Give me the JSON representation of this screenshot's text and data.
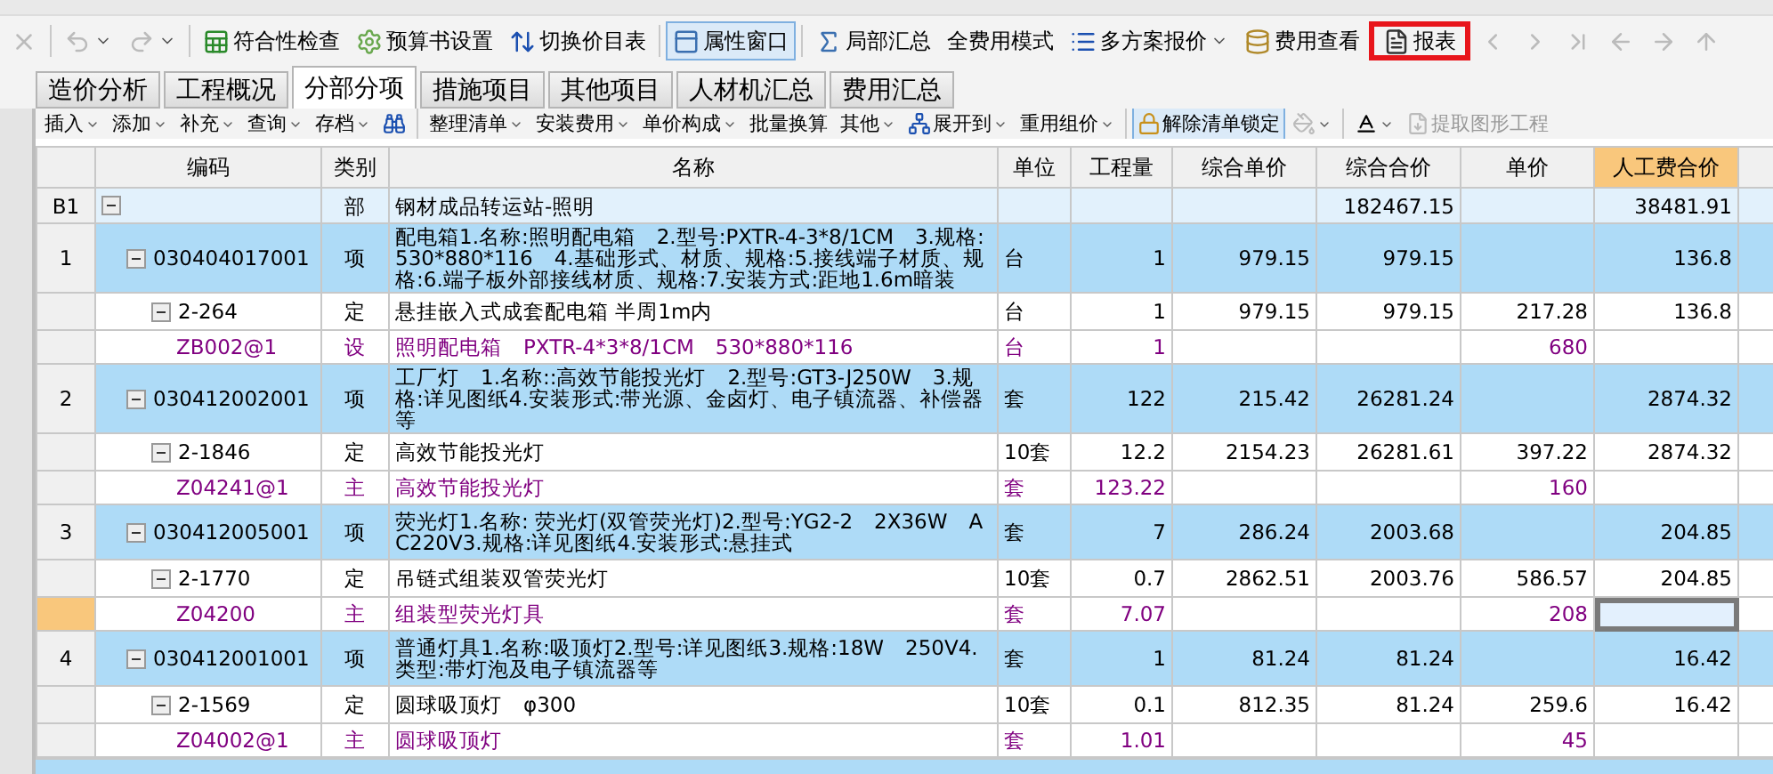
{
  "main_toolbar": [
    {
      "kind": "icon",
      "dropdown": false,
      "pressed": false,
      "highlighted": false,
      "disabled": true
    },
    {
      "kind": "icon",
      "dropdown": true,
      "pressed": false,
      "highlighted": false,
      "disabled": true
    },
    {
      "kind": "icon",
      "dropdown": true,
      "pressed": false,
      "highlighted": false,
      "disabled": true
    },
    {
      "kind": "button",
      "label": "符合性检查",
      "dropdown": false,
      "pressed": false,
      "highlighted": false,
      "disabled": false
    },
    {
      "kind": "button",
      "label": "预算书设置",
      "dropdown": false,
      "pressed": false,
      "highlighted": false,
      "disabled": false
    },
    {
      "kind": "button",
      "label": "切换价目表",
      "dropdown": false,
      "pressed": false,
      "highlighted": false,
      "disabled": false
    },
    {
      "kind": "button",
      "label": "属性窗口",
      "dropdown": false,
      "pressed": true,
      "highlighted": false,
      "disabled": false
    },
    {
      "kind": "button",
      "label": "局部汇总",
      "dropdown": false,
      "pressed": false,
      "highlighted": false,
      "disabled": false
    },
    {
      "kind": "text",
      "label": "全费用模式",
      "dropdown": false,
      "pressed": false,
      "highlighted": false,
      "disabled": false
    },
    {
      "kind": "button",
      "label": "多方案报价",
      "dropdown": true,
      "pressed": false,
      "highlighted": false,
      "disabled": false
    },
    {
      "kind": "button",
      "label": "费用查看",
      "dropdown": false,
      "pressed": false,
      "highlighted": false,
      "disabled": false
    },
    {
      "kind": "button",
      "label": "报表",
      "dropdown": false,
      "pressed": false,
      "highlighted": true,
      "disabled": false
    },
    {
      "kind": "icon",
      "dropdown": false,
      "pressed": false,
      "highlighted": false,
      "disabled": true
    },
    {
      "kind": "icon",
      "dropdown": false,
      "pressed": false,
      "highlighted": false,
      "disabled": true
    },
    {
      "kind": "icon",
      "dropdown": false,
      "pressed": false,
      "highlighted": false,
      "disabled": true
    },
    {
      "kind": "icon",
      "dropdown": false,
      "pressed": false,
      "highlighted": false,
      "disabled": true
    },
    {
      "kind": "icon",
      "dropdown": false,
      "pressed": false,
      "highlighted": false,
      "disabled": true
    },
    {
      "kind": "icon",
      "dropdown": false,
      "pressed": false,
      "highlighted": false,
      "disabled": true
    }
  ],
  "tabs": [
    {
      "label": "造价分析",
      "selected": false
    },
    {
      "label": "工程概况",
      "selected": false
    },
    {
      "label": "分部分项",
      "selected": true
    },
    {
      "label": "措施项目",
      "selected": false
    },
    {
      "label": "其他项目",
      "selected": false
    },
    {
      "label": "人材机汇总",
      "selected": false
    },
    {
      "label": "费用汇总",
      "selected": false
    }
  ],
  "edit_toolbar": [
    {
      "kind": "text",
      "label": "插入",
      "dropdown": true,
      "pressed": false,
      "disabled": false
    },
    {
      "kind": "text",
      "label": "添加",
      "dropdown": true,
      "pressed": false,
      "disabled": false
    },
    {
      "kind": "text",
      "label": "补充",
      "dropdown": true,
      "pressed": false,
      "disabled": false
    },
    {
      "kind": "text",
      "label": "查询",
      "dropdown": true,
      "pressed": false,
      "disabled": false
    },
    {
      "kind": "text",
      "label": "存档",
      "dropdown": true,
      "pressed": false,
      "disabled": false
    },
    {
      "kind": "icon",
      "dropdown": false,
      "pressed": false,
      "disabled": false
    },
    {
      "kind": "text",
      "label": "整理清单",
      "dropdown": true,
      "pressed": false,
      "disabled": false
    },
    {
      "kind": "text",
      "label": "安装费用",
      "dropdown": true,
      "pressed": false,
      "disabled": false
    },
    {
      "kind": "text",
      "label": "单价构成",
      "dropdown": true,
      "pressed": false,
      "disabled": false
    },
    {
      "kind": "text",
      "label": "批量换算",
      "dropdown": false,
      "pressed": false,
      "disabled": false
    },
    {
      "kind": "text",
      "label": "其他",
      "dropdown": true,
      "pressed": false,
      "disabled": false
    },
    {
      "kind": "button",
      "label": "展开到",
      "dropdown": true,
      "pressed": false,
      "disabled": false
    },
    {
      "kind": "text",
      "label": "重用组价",
      "dropdown": true,
      "pressed": false,
      "disabled": false
    },
    {
      "kind": "button",
      "label": "解除清单锁定",
      "dropdown": false,
      "pressed": true,
      "disabled": false
    },
    {
      "kind": "icon",
      "dropdown": true,
      "pressed": false,
      "disabled": true
    },
    {
      "kind": "icon",
      "dropdown": true,
      "pressed": false,
      "disabled": false
    },
    {
      "kind": "button",
      "label": "提取图形工程",
      "dropdown": false,
      "pressed": false,
      "disabled": true
    }
  ],
  "table": {
    "columns": [
      {
        "selected": false
      },
      {
        "label": "编码",
        "selected": false
      },
      {
        "label": "类别",
        "selected": false
      },
      {
        "label": "名称",
        "selected": false
      },
      {
        "label": "单位",
        "selected": false
      },
      {
        "label": "工程量",
        "selected": false
      },
      {
        "label": "综合单价",
        "selected": false
      },
      {
        "label": "综合合价",
        "selected": false
      },
      {
        "label": "单价",
        "selected": false
      },
      {
        "label": "人工费合价",
        "selected": true
      },
      {
        "selected": false
      }
    ],
    "rows": [
      {
        "kind": "section",
        "number": "B1",
        "type": "部",
        "name": "钢材成品转运站-照明",
        "total": "182467.15",
        "labor_total": "38481.91",
        "selected": false,
        "expanded": true,
        "children": [
          {
            "kind": "item",
            "number": "1",
            "code": "030404017001",
            "type": "项",
            "name": "配电箱1.名称:照明配电箱　2.型号:PXTR-4-3*8/1CM　3.规格:530*880*116　4.基础形式、材质、规格:5.接线端子材质、规格:6.端子板外部接线材质、规格:7.安装方式:距地1.6m暗装",
            "unit": "台",
            "quantity": "1",
            "unit_price": "979.15",
            "total": "979.15",
            "labor_total": "136.8",
            "selected": false,
            "expanded": true,
            "children": [
              {
                "kind": "quota",
                "code": "2-264",
                "type": "定",
                "name": "悬挂嵌入式成套配电箱 半周1m内",
                "unit": "台",
                "quantity": "1",
                "unit_price": "979.15",
                "total": "979.15",
                "price": "217.28",
                "labor_total": "136.8",
                "selected": false,
                "expanded": true,
                "children": [
                  {
                    "kind": "material",
                    "code": "ZB002@1",
                    "type": "设",
                    "name": "照明配电箱　PXTR-4*3*8/1CM　530*880*116",
                    "unit": "台",
                    "quantity": "1",
                    "price": "680",
                    "selected": false
                  }
                ]
              }
            ]
          },
          {
            "kind": "item",
            "number": "2",
            "code": "030412002001",
            "type": "项",
            "name": "工厂灯　1.名称::高效节能投光灯　2.型号:GT3-J250W　3.规格:详见图纸4.安装形式:带光源、金卤灯、电子镇流器、补偿器等",
            "unit": "套",
            "quantity": "122",
            "unit_price": "215.42",
            "total": "26281.24",
            "labor_total": "2874.32",
            "selected": false,
            "expanded": true,
            "children": [
              {
                "kind": "quota",
                "code": "2-1846",
                "type": "定",
                "name": "高效节能投光灯",
                "unit": "10套",
                "quantity": "12.2",
                "unit_price": "2154.23",
                "total": "26281.61",
                "price": "397.22",
                "labor_total": "2874.32",
                "selected": false,
                "expanded": true,
                "children": [
                  {
                    "kind": "material",
                    "code": "Z04241@1",
                    "type": "主",
                    "name": "高效节能投光灯",
                    "unit": "套",
                    "quantity": "123.22",
                    "price": "160",
                    "selected": false
                  }
                ]
              }
            ]
          },
          {
            "kind": "item",
            "number": "3",
            "code": "030412005001",
            "type": "项",
            "name": "荧光灯1.名称: 荧光灯(双管荧光灯)2.型号:YG2-2　2X36W　AC220V3.规格:详见图纸4.安装形式:悬挂式",
            "unit": "套",
            "quantity": "7",
            "unit_price": "286.24",
            "total": "2003.68",
            "labor_total": "204.85",
            "selected": false,
            "expanded": true,
            "children": [
              {
                "kind": "quota",
                "code": "2-1770",
                "type": "定",
                "name": "吊链式组装双管荧光灯",
                "unit": "10套",
                "quantity": "0.7",
                "unit_price": "2862.51",
                "total": "2003.76",
                "price": "586.57",
                "labor_total": "204.85",
                "selected": false,
                "expanded": true,
                "children": [
                  {
                    "kind": "material",
                    "code": "Z04200",
                    "type": "主",
                    "name": "组装型荧光灯具",
                    "unit": "套",
                    "quantity": "7.07",
                    "price": "208",
                    "selected": true
                  }
                ]
              }
            ]
          },
          {
            "kind": "item",
            "number": "4",
            "code": "030412001001",
            "type": "项",
            "name": "普通灯具1.名称:吸顶灯2.型号:详见图纸3.规格:18W　250V4.类型:带灯泡及电子镇流器等",
            "unit": "套",
            "quantity": "1",
            "unit_price": "81.24",
            "total": "81.24",
            "labor_total": "16.42",
            "selected": false,
            "expanded": true,
            "children": [
              {
                "kind": "quota",
                "code": "2-1569",
                "type": "定",
                "name": "圆球吸顶灯　φ300",
                "unit": "10套",
                "quantity": "0.1",
                "unit_price": "812.35",
                "total": "81.24",
                "price": "259.6",
                "labor_total": "16.42",
                "selected": false,
                "expanded": true,
                "children": [
                  {
                    "kind": "material",
                    "code": "Z04002@1",
                    "type": "主",
                    "name": "圆球吸顶灯",
                    "unit": "套",
                    "quantity": "1.01",
                    "price": "45",
                    "selected": false
                  }
                ]
              }
            ]
          }
        ]
      }
    ]
  }
}
